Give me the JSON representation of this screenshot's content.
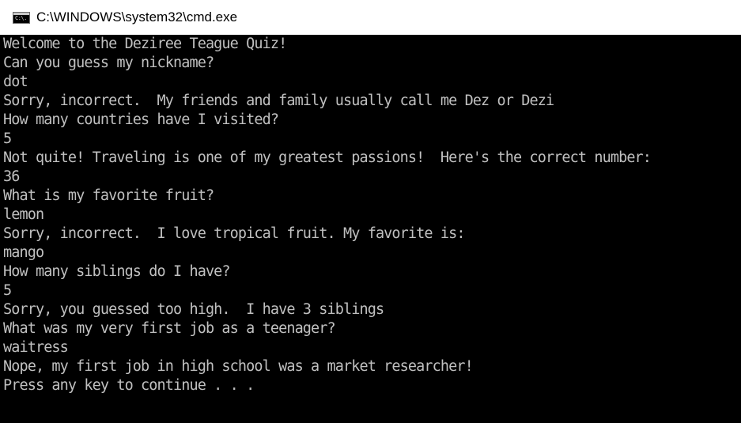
{
  "window": {
    "title": "C:\\WINDOWS\\system32\\cmd.exe",
    "icon": "cmd-icon",
    "icon_glyph": "C:\\."
  },
  "colors": {
    "titlebar_bg": "#ffffff",
    "console_bg": "#000000",
    "console_text": "#c0c0c0"
  },
  "console": {
    "lines": [
      "Welcome to the Deziree Teague Quiz!",
      "Can you guess my nickname?",
      "dot",
      "Sorry, incorrect.  My friends and family usually call me Dez or Dezi",
      "How many countries have I visited?",
      "5",
      "Not quite! Traveling is one of my greatest passions!  Here's the correct number:",
      "36",
      "What is my favorite fruit?",
      "lemon",
      "Sorry, incorrect.  I love tropical fruit. My favorite is:",
      "mango",
      "How many siblings do I have?",
      "5",
      "Sorry, you guessed too high.  I have 3 siblings",
      "What was my very first job as a teenager?",
      "waitress",
      "Nope, my first job in high school was a market researcher!",
      "Press any key to continue . . ."
    ]
  }
}
